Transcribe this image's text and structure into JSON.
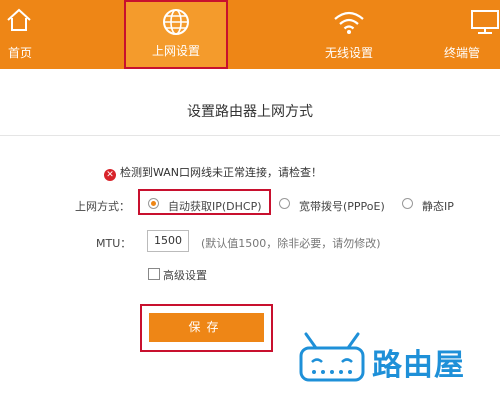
{
  "nav": {
    "tabs": [
      {
        "label": "首页",
        "icon": "home-icon"
      },
      {
        "label": "上网设置",
        "icon": "globe-icon",
        "active": true
      },
      {
        "label": "无线设置",
        "icon": "wifi-icon"
      },
      {
        "label": "终端管",
        "icon": "monitor-icon"
      }
    ]
  },
  "page": {
    "title": "设置路由器上网方式",
    "error_message": "检测到WAN口网线未正常连接，请检查！",
    "connection_label": "上网方式：",
    "options": [
      {
        "label": "自动获取IP(DHCP)",
        "selected": true
      },
      {
        "label": "宽带拨号(PPPoE)",
        "selected": false
      },
      {
        "label": "静态IP",
        "selected": false
      }
    ],
    "mtu_label": "MTU：",
    "mtu_value": "1500",
    "mtu_hint": "(默认值1500，除非必要，请勿修改)",
    "advanced_label": "高级设置",
    "save_label": "保存"
  },
  "watermark": {
    "text": "路由屋"
  },
  "colors": {
    "accent": "#ee8616",
    "highlight": "#c8102e",
    "brand": "#1e90d8"
  }
}
